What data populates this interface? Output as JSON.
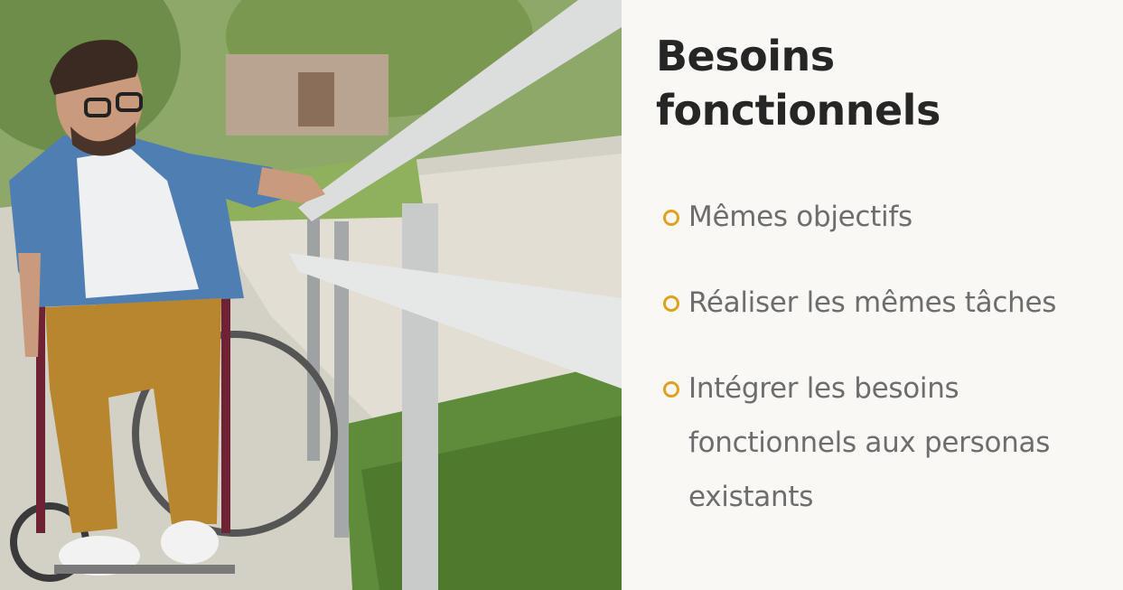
{
  "slide": {
    "title_line1": "Besoins",
    "title_line2": "fonctionnels",
    "bullets": [
      {
        "lines": [
          "Mêmes objectifs"
        ]
      },
      {
        "lines": [
          "Réaliser les mêmes tâches"
        ]
      },
      {
        "lines": [
          "Intégrer les besoins",
          "fonctionnels aux personas",
          "existants"
        ]
      }
    ]
  },
  "colors": {
    "title": "#262626",
    "bullet_text": "#6d6d6d",
    "bullet_marker": "#e0a020",
    "panel_background": "#f9f8f4"
  }
}
